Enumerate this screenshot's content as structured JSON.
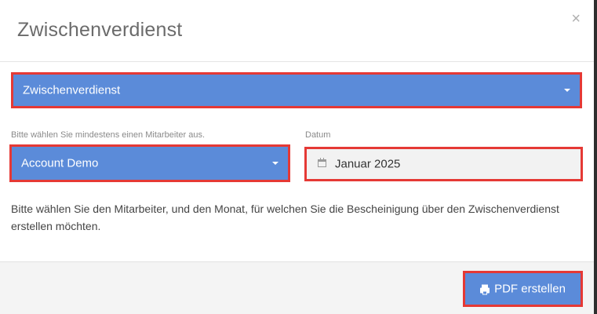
{
  "dialog": {
    "title": "Zwischenverdienst",
    "close_label": "×"
  },
  "report_type": {
    "selected": "Zwischenverdienst"
  },
  "employee": {
    "label": "Bitte wählen Sie mindestens einen Mitarbeiter aus.",
    "selected": "Account Demo"
  },
  "date": {
    "label": "Datum",
    "value": "Januar 2025"
  },
  "description": "Bitte wählen Sie den Mitarbeiter, und den Monat, für welchen Sie die Bescheinigung über den Zwischenverdienst erstellen möchten.",
  "footer": {
    "pdf_button_label": "PDF erstellen"
  },
  "icons": {
    "close": "close-icon",
    "caret": "caret-down-icon",
    "calendar": "calendar-icon",
    "print": "print-icon"
  },
  "colors": {
    "accent": "#5b8bd9",
    "highlight": "#e53935",
    "footer_bg": "#f4f4f4"
  }
}
